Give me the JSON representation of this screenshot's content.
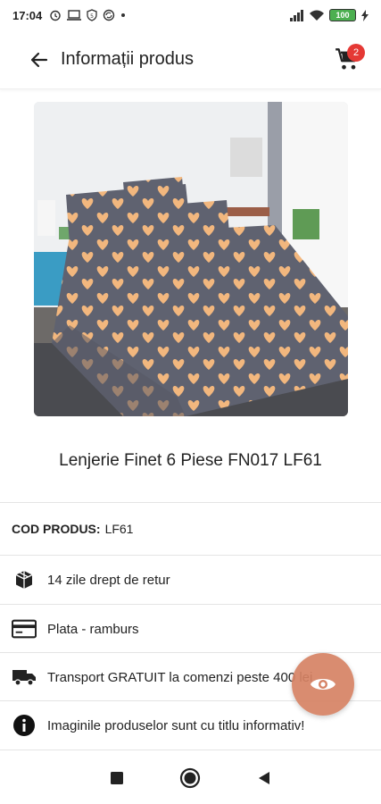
{
  "status_bar": {
    "time": "17:04",
    "battery": "100",
    "icons": [
      "alarm-icon",
      "laptop-icon",
      "shield-icon",
      "sync-icon",
      "dot-icon",
      "signal-icon",
      "wifi-icon",
      "battery-icon",
      "charging-icon"
    ]
  },
  "header": {
    "title": "Informații produs",
    "cart_count": "2"
  },
  "product": {
    "title": "Lenjerie Finet 6 Piese FN017 LF61",
    "code_label": "COD PRODUS:",
    "code_value": "LF61",
    "image_subject": "bedding set with peach hearts on grey"
  },
  "info_rows": [
    {
      "icon": "box-icon",
      "text": "14 zile drept de retur"
    },
    {
      "icon": "credit-card-icon",
      "text": "Plata - ramburs"
    },
    {
      "icon": "truck-icon",
      "text": "Transport GRATUIT la comenzi peste 400 lei"
    },
    {
      "icon": "info-icon",
      "text": "Imaginile produselor sunt cu titlu informativ!"
    }
  ],
  "colors": {
    "fab": "#d68264",
    "badge": "#e53935",
    "bedding": "#5f6270",
    "hearts": "#f2b77e"
  }
}
